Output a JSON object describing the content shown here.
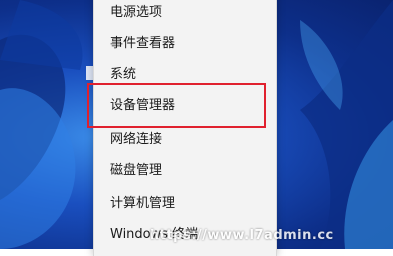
{
  "context_menu": {
    "items": [
      {
        "label": "电源选项"
      },
      {
        "label": "事件查看器"
      },
      {
        "label": "系统"
      },
      {
        "label": "设备管理器"
      },
      {
        "label": "网络连接"
      },
      {
        "label": "磁盘管理"
      },
      {
        "label": "计算机管理"
      },
      {
        "label": "Windows 终端"
      }
    ],
    "highlighted_item": "设备管理器"
  },
  "highlight_color": "#e0202e",
  "watermark": {
    "text": "https://www.l7admin.cc"
  }
}
